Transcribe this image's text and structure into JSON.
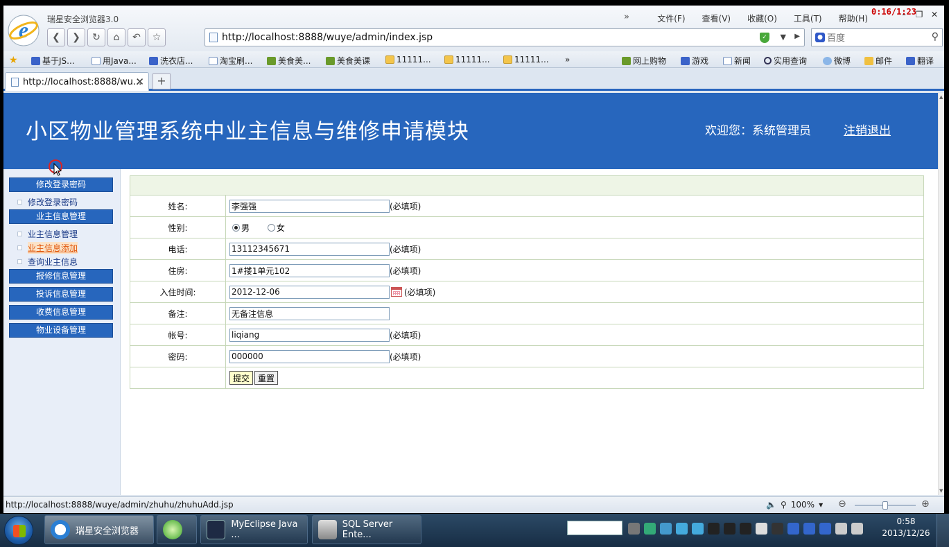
{
  "browser": {
    "app_title": "瑞星安全浏览器3.0",
    "menu": [
      "文件(F)",
      "查看(V)",
      "收藏(O)",
      "工具(T)",
      "帮助(H)"
    ],
    "menu_chevron": "»",
    "timer": "0:16/1:23",
    "url": "http://localhost:8888/wuye/admin/index.jsp",
    "search_placeholder": "百度",
    "favorites": [
      "基于JS...",
      "用Java...",
      "洗衣店...",
      "淘宝刷...",
      "美食美...",
      "美食美课",
      "11111...",
      "11111...",
      "11111..."
    ],
    "favorites_more": "»",
    "favorites_right": [
      "网上购物",
      "游戏",
      "新闻",
      "实用查询",
      "微博",
      "邮件",
      "翻译"
    ],
    "tab_title": "http://localhost:8888/wu...",
    "new_tab": "+"
  },
  "page": {
    "title": "小区物业管理系统中业主信息与维修申请模块",
    "welcome": "欢迎您：系统管理员",
    "logout": "注销退出"
  },
  "sidebar": {
    "groups": [
      {
        "header": "修改登录密码",
        "items": [
          "修改登录密码"
        ]
      },
      {
        "header": "业主信息管理",
        "items": [
          "业主信息管理",
          "业主信息添加",
          "查询业主信息"
        ]
      },
      {
        "header": "报修信息管理",
        "items": []
      },
      {
        "header": "投诉信息管理",
        "items": []
      },
      {
        "header": "收费信息管理",
        "items": []
      },
      {
        "header": "物业设备管理",
        "items": []
      }
    ],
    "active_item": "业主信息添加"
  },
  "form": {
    "required_mark": "(必填项)",
    "name_label": "姓名:",
    "name_value": "李强强",
    "gender_label": "性别:",
    "gender_male": "男",
    "gender_female": "女",
    "gender_selected": "男",
    "phone_label": "电话:",
    "phone_value": "13112345671",
    "house_label": "住房:",
    "house_value": "1#搂1单元102",
    "checkin_label": "入住时间:",
    "checkin_value": "2012-12-06",
    "remark_label": "备注:",
    "remark_value": "无备注信息",
    "account_label": "帐号:",
    "account_value": "liqiang",
    "password_label": "密码:",
    "password_value": "000000",
    "submit_label": "提交",
    "reset_label": "重置"
  },
  "status": {
    "url": "http://localhost:8888/wuye/admin/zhuhu/zhuhuAdd.jsp",
    "zoom": "100%"
  },
  "taskbar": {
    "items": [
      "瑞星安全浏览器",
      "",
      "MyEclipse Java ...",
      "SQL Server Ente..."
    ],
    "time": "0:58",
    "date": "2013/12/26"
  },
  "colors": {
    "banner": "#2766bd",
    "sidebar_header": "#2766bd",
    "active_link": "#e25a10",
    "row_header": "#eef5e6"
  }
}
